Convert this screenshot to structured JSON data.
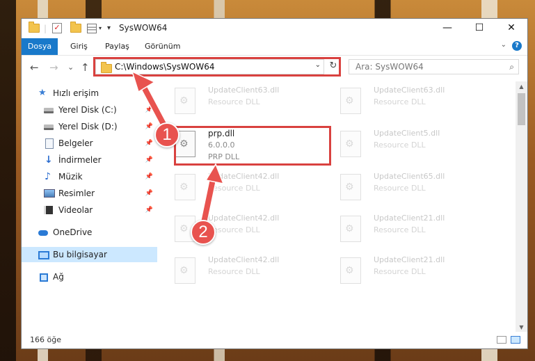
{
  "window": {
    "title": "SysWOW64",
    "minimize_glyph": "—",
    "maximize_glyph": "☐",
    "close_glyph": "✕"
  },
  "menu": {
    "items": [
      "Dosya",
      "Giriş",
      "Paylaş",
      "Görünüm"
    ],
    "help_glyph": "?",
    "expand_glyph": "⌄"
  },
  "nav": {
    "back_glyph": "←",
    "forward_glyph": "→",
    "recent_glyph": "⌄",
    "up_glyph": "↑",
    "address": "C:\\Windows\\SysWOW64",
    "address_dd": "⌄",
    "refresh_glyph": "↻",
    "search_placeholder": "Ara: SysWOW64",
    "search_icon": "⌕"
  },
  "sidebar": {
    "pin_glyph": "📌",
    "items": [
      {
        "label": "Hızlı erişim",
        "icon": "star-icon"
      },
      {
        "label": "Yerel Disk (C:)",
        "icon": "drive-icon"
      },
      {
        "label": "Yerel Disk (D:)",
        "icon": "drive-icon"
      },
      {
        "label": "Belgeler",
        "icon": "document-icon"
      },
      {
        "label": "İndirmeler",
        "icon": "download-icon"
      },
      {
        "label": "Müzik",
        "icon": "music-icon"
      },
      {
        "label": "Resimler",
        "icon": "pictures-icon"
      },
      {
        "label": "Videolar",
        "icon": "video-icon"
      },
      {
        "label": "OneDrive",
        "icon": "cloud-icon"
      },
      {
        "label": "Bu bilgisayar",
        "icon": "computer-icon"
      },
      {
        "label": "Ağ",
        "icon": "network-icon"
      }
    ]
  },
  "files": {
    "left": [
      {
        "name": "UpdateClient63.dll",
        "desc": "Resource DLL"
      },
      {
        "name": "prp.dll",
        "desc": "6.0.0.0",
        "desc2": "PRP DLL"
      },
      {
        "name": "UpdateClient42.dll",
        "desc": "Resource DLL"
      },
      {
        "name": "UpdateClient42.dll",
        "desc": "Resource DLL"
      },
      {
        "name": "UpdateClient42.dll",
        "desc": "Resource DLL"
      }
    ],
    "right": [
      {
        "name": "UpdateClient63.dll",
        "desc": "Resource DLL"
      },
      {
        "name": "UpdateClient5.dll",
        "desc": "Resource DLL"
      },
      {
        "name": "UpdateClient65.dll",
        "desc": "Resource DLL"
      },
      {
        "name": "UpdateClient21.dll",
        "desc": "Resource DLL"
      },
      {
        "name": "UpdateClient21.dll",
        "desc": "Resource DLL"
      }
    ]
  },
  "scrollbar": {
    "up_glyph": "▲",
    "down_glyph": "▼"
  },
  "status": {
    "count": "166 öğe"
  },
  "annotations": {
    "step1": "1",
    "step2": "2",
    "color": "#e8534f"
  }
}
